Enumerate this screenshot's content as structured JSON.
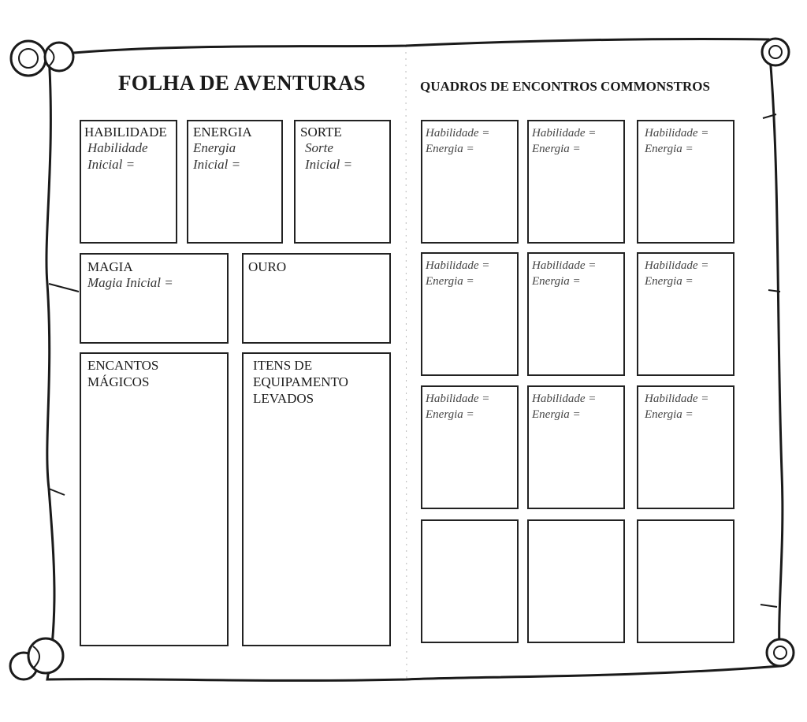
{
  "sheet": {
    "title": "FOLHA DE AVENTURAS",
    "habilidade": {
      "label": "HABILIDADE",
      "initial_line1": "Habilidade",
      "initial_line2": "Inicial ="
    },
    "energia": {
      "label": "ENERGIA",
      "initial_line1": "Energia",
      "initial_line2": "Inicial ="
    },
    "sorte": {
      "label": "SORTE",
      "initial_line1": "Sorte",
      "initial_line2": "Inicial ="
    },
    "magia": {
      "label": "MAGIA",
      "initial": "Magia Inicial ="
    },
    "ouro": {
      "label": "OURO"
    },
    "encantos": {
      "line1": "ENCANTOS",
      "line2": "MÁGICOS"
    },
    "itens": {
      "line1": "ITENS DE",
      "line2": "EQUIPAMENTO",
      "line3": "LEVADOS"
    }
  },
  "encounters": {
    "title": "QUADROS DE ENCONTROS COMMONSTROS",
    "skill_label": "Habilidade =",
    "stamina_label": "Energia ="
  }
}
